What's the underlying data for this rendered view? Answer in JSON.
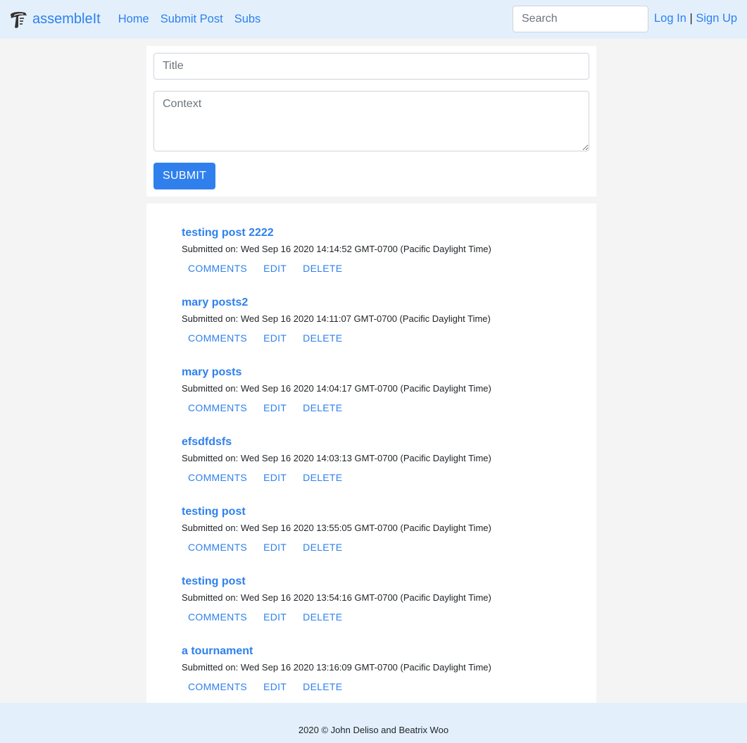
{
  "navbar": {
    "brand": "assembleIt",
    "links": [
      "Home",
      "Submit Post",
      "Subs"
    ],
    "search_placeholder": "Search",
    "login": "Log In",
    "separator": "|",
    "signup": "Sign Up"
  },
  "form": {
    "title_placeholder": "Title",
    "context_placeholder": "Context",
    "submit_label": "SUBMIT"
  },
  "posts": [
    {
      "title": "testing post 2222",
      "date": "Submitted on: Wed Sep 16 2020 14:14:52 GMT-0700 (Pacific Daylight Time)"
    },
    {
      "title": "mary posts2",
      "date": "Submitted on: Wed Sep 16 2020 14:11:07 GMT-0700 (Pacific Daylight Time)"
    },
    {
      "title": "mary posts",
      "date": "Submitted on: Wed Sep 16 2020 14:04:17 GMT-0700 (Pacific Daylight Time)"
    },
    {
      "title": "efsdfdsfs",
      "date": "Submitted on: Wed Sep 16 2020 14:03:13 GMT-0700 (Pacific Daylight Time)"
    },
    {
      "title": "testing post",
      "date": "Submitted on: Wed Sep 16 2020 13:55:05 GMT-0700 (Pacific Daylight Time)"
    },
    {
      "title": "testing post",
      "date": "Submitted on: Wed Sep 16 2020 13:54:16 GMT-0700 (Pacific Daylight Time)"
    },
    {
      "title": "a tournament",
      "date": "Submitted on: Wed Sep 16 2020 13:16:09 GMT-0700 (Pacific Daylight Time)"
    }
  ],
  "post_actions": {
    "comments": "COMMENTS",
    "edit": "EDIT",
    "delete": "DELETE"
  },
  "footer": {
    "text": "2020 © John Deliso and Beatrix Woo"
  },
  "colors": {
    "accent": "#2f80ed",
    "navbar_bg": "#e3f0fc",
    "page_bg": "#f4f4f4"
  }
}
